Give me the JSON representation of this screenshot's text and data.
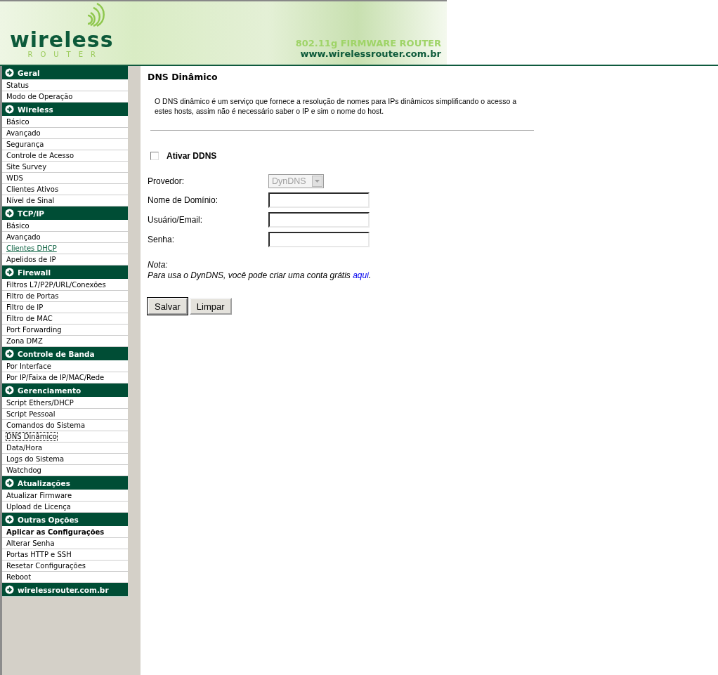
{
  "header": {
    "logo_word": "wireless",
    "logo_sub": "ROUTER",
    "tagline": "802.11g FIRMWARE ROUTER",
    "url": "www.wirelessrouter.com.br"
  },
  "sidebar": {
    "sections": [
      {
        "title": "Geral",
        "items": [
          {
            "label": "Status",
            "selected": false,
            "hovered": false,
            "bold": false
          },
          {
            "label": "Modo de Operação",
            "selected": false,
            "hovered": false,
            "bold": false
          }
        ]
      },
      {
        "title": "Wireless",
        "items": [
          {
            "label": "Básico",
            "selected": false,
            "hovered": false,
            "bold": false
          },
          {
            "label": "Avançado",
            "selected": false,
            "hovered": false,
            "bold": false
          },
          {
            "label": "Segurança",
            "selected": false,
            "hovered": false,
            "bold": false
          },
          {
            "label": "Controle de Acesso",
            "selected": false,
            "hovered": false,
            "bold": false
          },
          {
            "label": "Site Survey",
            "selected": false,
            "hovered": false,
            "bold": false
          },
          {
            "label": "WDS",
            "selected": false,
            "hovered": false,
            "bold": false
          },
          {
            "label": "Clientes Ativos",
            "selected": false,
            "hovered": false,
            "bold": false
          },
          {
            "label": "Nível de Sinal",
            "selected": false,
            "hovered": false,
            "bold": false
          }
        ]
      },
      {
        "title": "TCP/IP",
        "items": [
          {
            "label": "Básico",
            "selected": false,
            "hovered": false,
            "bold": false
          },
          {
            "label": "Avançado",
            "selected": false,
            "hovered": false,
            "bold": false
          },
          {
            "label": "Clientes DHCP",
            "selected": false,
            "hovered": true,
            "bold": false
          },
          {
            "label": "Apelidos de IP",
            "selected": false,
            "hovered": false,
            "bold": false
          }
        ]
      },
      {
        "title": "Firewall",
        "items": [
          {
            "label": "Filtros L7/P2P/URL/Conexões",
            "selected": false,
            "hovered": false,
            "bold": false
          },
          {
            "label": "Filtro de Portas",
            "selected": false,
            "hovered": false,
            "bold": false
          },
          {
            "label": "Filtro de IP",
            "selected": false,
            "hovered": false,
            "bold": false
          },
          {
            "label": "Filtro de MAC",
            "selected": false,
            "hovered": false,
            "bold": false
          },
          {
            "label": "Port Forwarding",
            "selected": false,
            "hovered": false,
            "bold": false
          },
          {
            "label": "Zona DMZ",
            "selected": false,
            "hovered": false,
            "bold": false
          }
        ]
      },
      {
        "title": "Controle de Banda",
        "items": [
          {
            "label": "Por Interface",
            "selected": false,
            "hovered": false,
            "bold": false
          },
          {
            "label": "Por IP/Faixa de IP/MAC/Rede",
            "selected": false,
            "hovered": false,
            "bold": false
          }
        ]
      },
      {
        "title": "Gerenciamento",
        "items": [
          {
            "label": "Script Ethers/DHCP",
            "selected": false,
            "hovered": false,
            "bold": false
          },
          {
            "label": "Script Pessoal",
            "selected": false,
            "hovered": false,
            "bold": false
          },
          {
            "label": "Comandos do Sistema",
            "selected": false,
            "hovered": false,
            "bold": false
          },
          {
            "label": "DNS Dinâmico",
            "selected": true,
            "hovered": false,
            "bold": false
          },
          {
            "label": "Data/Hora",
            "selected": false,
            "hovered": false,
            "bold": false
          },
          {
            "label": "Logs do Sistema",
            "selected": false,
            "hovered": false,
            "bold": false
          },
          {
            "label": "Watchdog",
            "selected": false,
            "hovered": false,
            "bold": false
          }
        ]
      },
      {
        "title": "Atualizações",
        "items": [
          {
            "label": "Atualizar Firmware",
            "selected": false,
            "hovered": false,
            "bold": false
          },
          {
            "label": "Upload de Licença",
            "selected": false,
            "hovered": false,
            "bold": false
          }
        ]
      },
      {
        "title": "Outras Opções",
        "items": [
          {
            "label": "Aplicar as Configurações",
            "selected": false,
            "hovered": false,
            "bold": true
          },
          {
            "label": "Alterar Senha",
            "selected": false,
            "hovered": false,
            "bold": false
          },
          {
            "label": "Portas HTTP e SSH",
            "selected": false,
            "hovered": false,
            "bold": false
          },
          {
            "label": "Resetar Configurações",
            "selected": false,
            "hovered": false,
            "bold": false
          },
          {
            "label": "Reboot",
            "selected": false,
            "hovered": false,
            "bold": false
          }
        ]
      },
      {
        "title": "wirelessrouter.com.br"
      }
    ]
  },
  "content": {
    "title": "DNS Dinâmico",
    "description": "O DNS dinâmico é um serviço que fornece a resolução de nomes para IPs dinâmicos simplificando o acesso a estes hosts, assim não é necessário saber o IP e sim o nome do host.",
    "enable": {
      "label": "Ativar DDNS",
      "checked": false
    },
    "fields": [
      {
        "kind": "select",
        "label": "Provedor:",
        "value": "DynDNS",
        "disabled": true
      },
      {
        "kind": "text",
        "label": "Nome de Domínio:"
      },
      {
        "kind": "text",
        "label": "Usuário/Email:"
      },
      {
        "kind": "password",
        "label": "Senha:"
      }
    ],
    "note_title": "Nota:",
    "note_text": "Para usa o DynDNS, você pode criar uma conta grátis ",
    "note_link": "aqui",
    "note_end": ".",
    "buttons": [
      {
        "label": "Salvar",
        "default": true
      },
      {
        "label": "Limpar",
        "default": false
      }
    ]
  }
}
